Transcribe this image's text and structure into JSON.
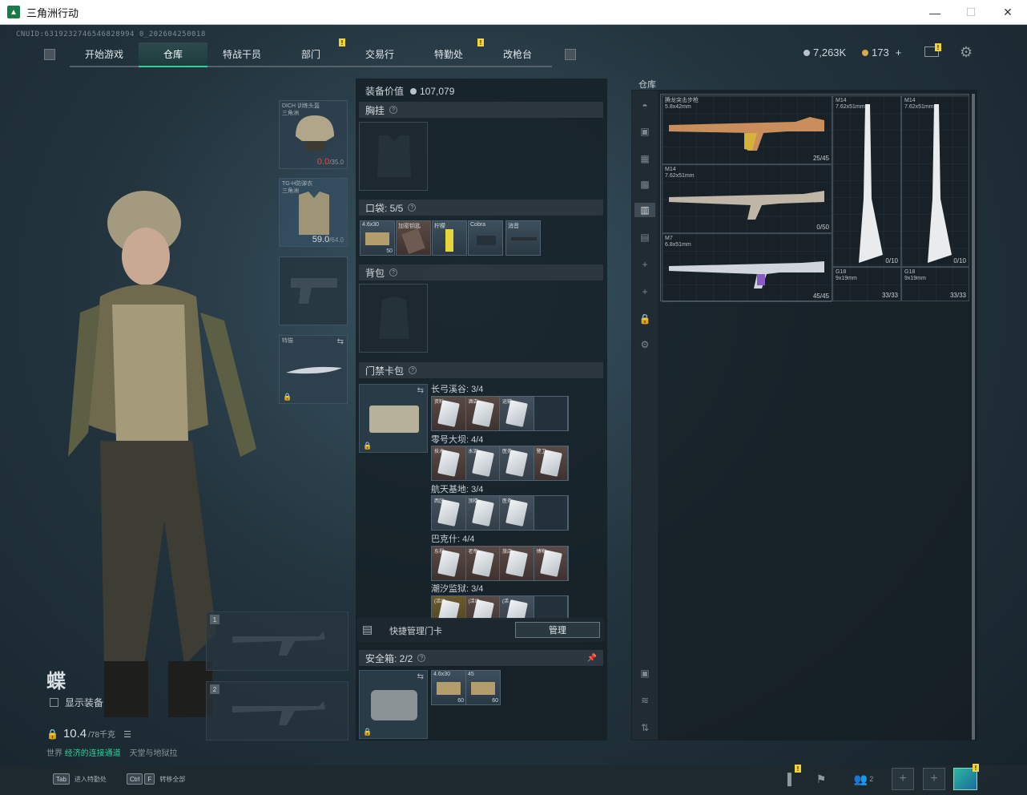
{
  "window": {
    "title": "三角洲行动",
    "minimize": "—",
    "maximize": "☐",
    "close": "✕"
  },
  "uid": "CNUID:6319232746546828994 0_202604250018",
  "nav": {
    "tabs": [
      {
        "label": "开始游戏",
        "active": false
      },
      {
        "label": "仓库",
        "active": true
      },
      {
        "label": "特战干员",
        "active": false
      },
      {
        "label": "部门",
        "active": false
      },
      {
        "label": "交易行",
        "active": false
      },
      {
        "label": "特勤处",
        "active": false
      },
      {
        "label": "改枪台",
        "active": false
      }
    ],
    "badge": "!"
  },
  "currency": {
    "silver": "7,263K",
    "gold": "173",
    "plus": "+"
  },
  "character": {
    "name": "蝶",
    "show_equipment": "显示装备",
    "weight": "10.4",
    "weight_max": "/78千克",
    "status_prefix": "世界",
    "status_green": "经济的连接通道",
    "status_suffix": "天堂与地狱拉"
  },
  "equip_slots": {
    "helmet": {
      "label": "DICH 训练头盔\n三角洲",
      "value": "0.0",
      "max": "/35.0"
    },
    "armor": {
      "label": "TG-H防弹衣\n三角洲",
      "value": "59.0",
      "max": "/64.0"
    },
    "melee": {
      "label": "特猫"
    },
    "weapon1_num": "1",
    "weapon2_num": "2"
  },
  "loadout": {
    "value_label": "装备价值",
    "value": "107,079",
    "chest_rig": "胸挂",
    "pockets": "口袋: 5/5",
    "backpack": "背包",
    "keycard_bag": "门禁卡包",
    "pocket_items": [
      {
        "label": "4.6x30",
        "count": "50"
      },
      {
        "label": "加密钥匙"
      },
      {
        "label": "柠檬"
      },
      {
        "label": "Cobra"
      },
      {
        "label": "消音"
      }
    ],
    "quick_manage": "快捷管理门卡",
    "manage_btn": "管理",
    "safe_box": "安全箱: 2/2",
    "safe_items": [
      {
        "label": "4.6x30",
        "count": "60"
      },
      {
        "label": "45",
        "count": "60"
      }
    ]
  },
  "keycards": [
    {
      "map": "长弓溪谷: 3/4",
      "cards": [
        "资料",
        "酒店",
        "运输"
      ]
    },
    {
      "map": "零号大坝: 4/4",
      "cards": [
        "技术",
        "水泥",
        "医务",
        "警卫"
      ]
    },
    {
      "map": "航天基地: 3/4",
      "cards": [
        "西区",
        "顶楼",
        "医务"
      ]
    },
    {
      "map": "巴克什: 4/4",
      "cards": [
        "东视",
        "老帝",
        "旅店",
        "博物"
      ]
    },
    {
      "map": "潮汐监狱: 3/4",
      "cards": [
        "(活动",
        "(活动",
        "(活"
      ]
    }
  ],
  "storage": {
    "title": "仓库",
    "weapons": [
      {
        "name": "腾龙突击步枪",
        "caliber": "5.8x42mm",
        "ammo": "25/45"
      },
      {
        "name": "M14",
        "caliber": "7.62x51mm",
        "ammo": "0/50"
      },
      {
        "name": "M7",
        "caliber": "6.8x51mm",
        "ammo": "45/45"
      },
      {
        "name": "M14",
        "caliber": "7.62x51mm",
        "ammo": "0/10"
      },
      {
        "name": "M14",
        "caliber": "7.62x51mm",
        "ammo": "0/10"
      },
      {
        "name": "G18",
        "caliber": "9x19mm",
        "ammo": "33/33"
      },
      {
        "name": "G18",
        "caliber": "9x19mm",
        "ammo": "33/33"
      }
    ]
  },
  "bottom": {
    "hint1_key": "Tab",
    "hint1_text": "进入特勤处",
    "hint2_key1": "Ctrl",
    "hint2_key2": "F",
    "hint2_text": "转移全部",
    "friends_count": "2"
  }
}
